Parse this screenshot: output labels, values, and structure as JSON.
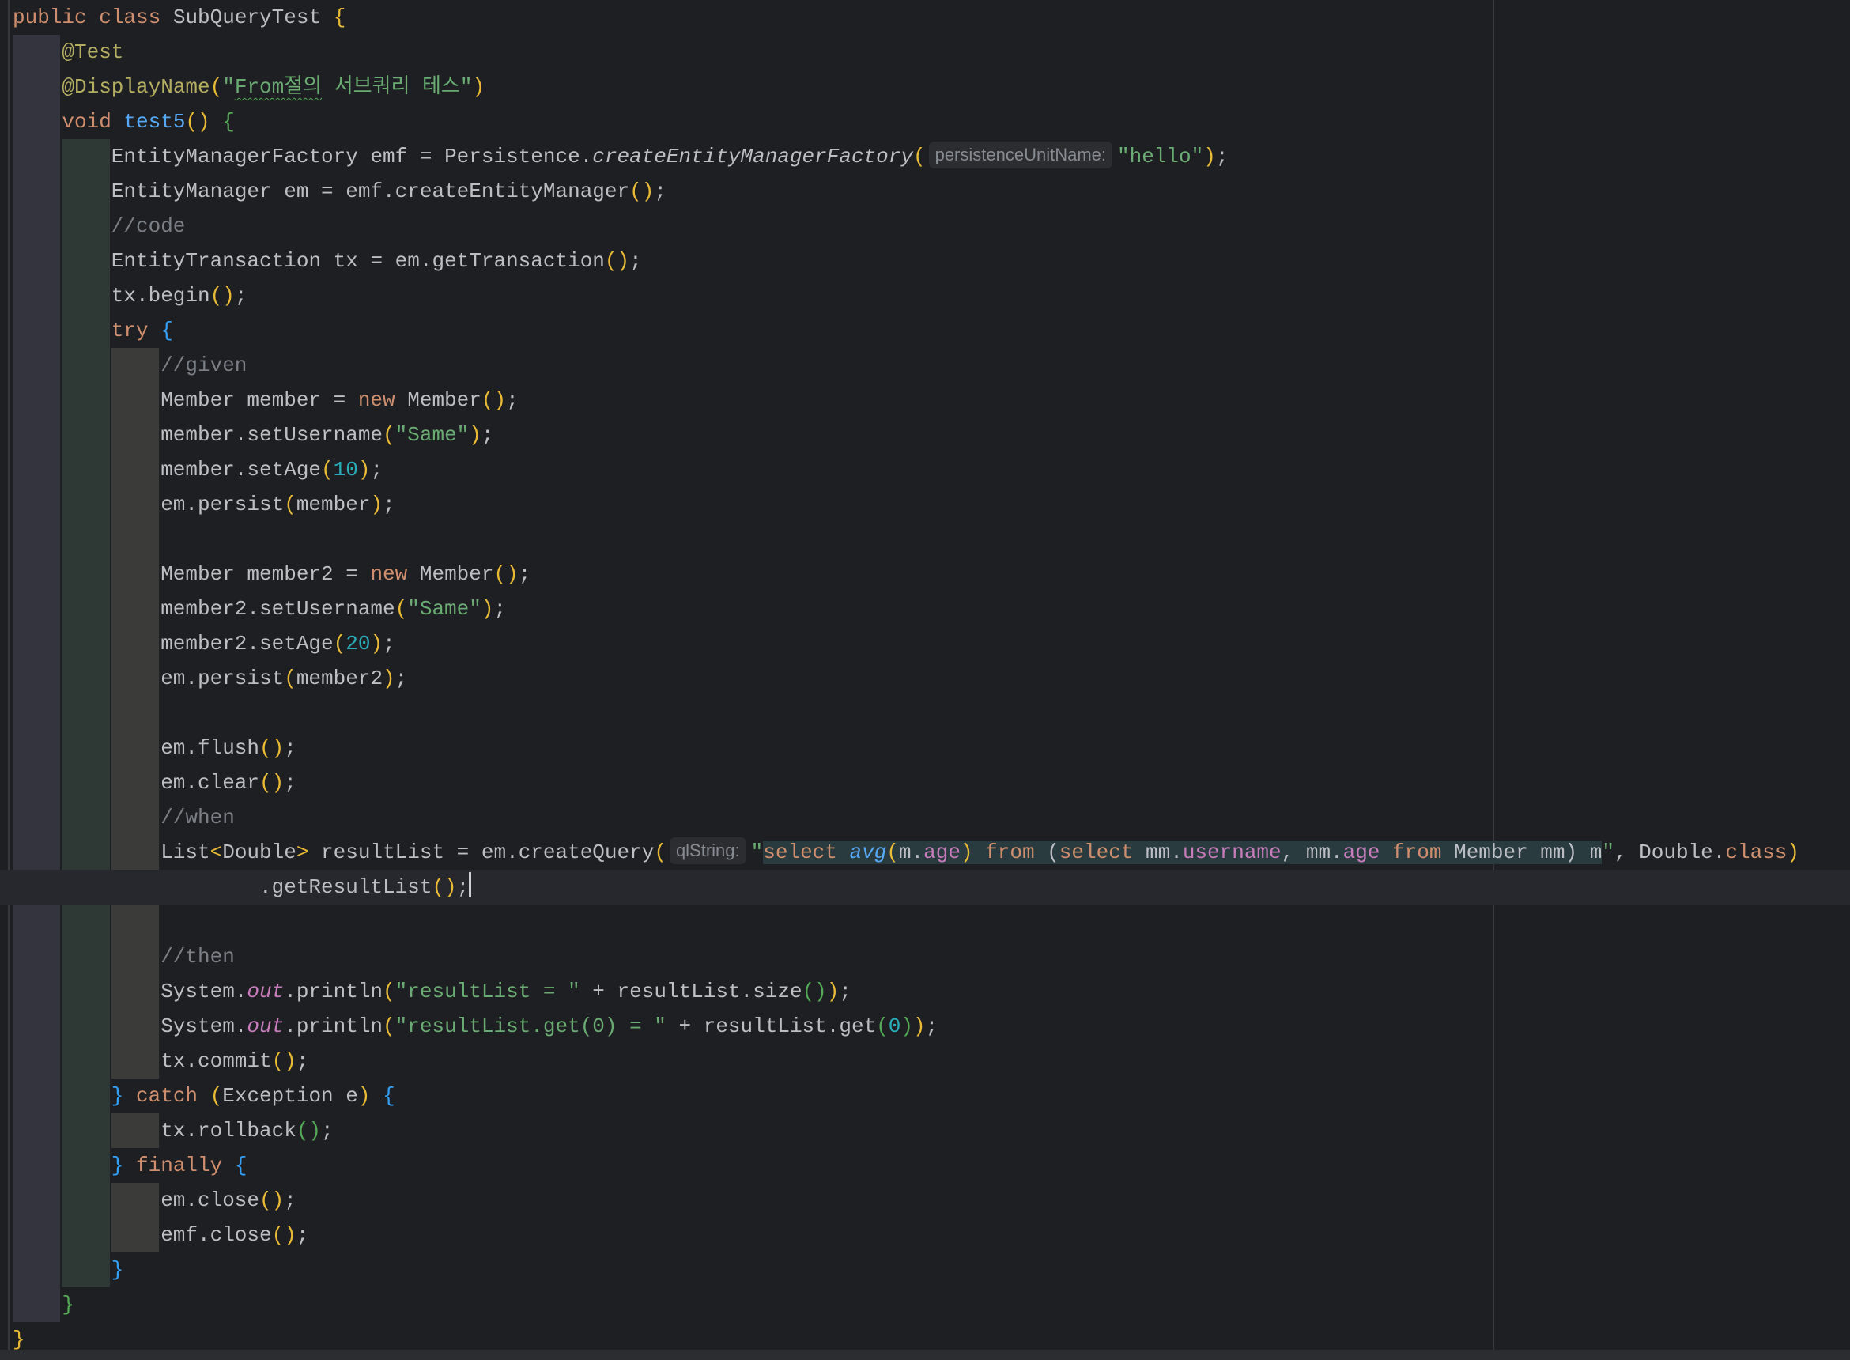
{
  "editor": {
    "file_class": "SubQueryTest",
    "current_line": 25,
    "caret_after_text": ".getResultList();",
    "colors": {
      "background": "#1e1f22",
      "current_line": "#26282e",
      "keyword": "#cf8e6d",
      "annotation": "#b3ae60",
      "string": "#6aab73",
      "number": "#2aacb8",
      "comment": "#7a7e85",
      "method_decl": "#56a8f5",
      "field": "#c77dbb",
      "text": "#bcbec4",
      "injected_language_bg": "#293b3f",
      "bracket_level_1": "#e8ba36",
      "bracket_level_2": "#54a857",
      "bracket_level_3": "#359ff4"
    },
    "lines": [
      {
        "indent": 0,
        "tokens": [
          {
            "t": "public class ",
            "c": "kw"
          },
          {
            "t": "SubQueryTest ",
            "c": "plain"
          },
          {
            "t": "{",
            "c": "b1"
          }
        ]
      },
      {
        "indent": 1,
        "tokens": [
          {
            "t": "@Test",
            "c": "ann"
          }
        ]
      },
      {
        "indent": 1,
        "tokens": [
          {
            "t": "@DisplayName",
            "c": "ann"
          },
          {
            "t": "(",
            "c": "b1"
          },
          {
            "t": "\"",
            "c": "str"
          },
          {
            "t": "From절의",
            "c": "str squiggle"
          },
          {
            "t": " 서브쿼리 테스\"",
            "c": "str"
          },
          {
            "t": ")",
            "c": "b1"
          }
        ]
      },
      {
        "indent": 1,
        "tokens": [
          {
            "t": "void ",
            "c": "kw"
          },
          {
            "t": "test5",
            "c": "fn"
          },
          {
            "t": "()",
            "c": "b1"
          },
          {
            "t": " ",
            "c": "plain"
          },
          {
            "t": "{",
            "c": "b2"
          }
        ]
      },
      {
        "indent": 2,
        "tokens": [
          {
            "t": "EntityManagerFactory emf = Persistence.",
            "c": "plain"
          },
          {
            "t": "createEntityManagerFactory",
            "c": "plain ital"
          },
          {
            "t": "(",
            "c": "b1"
          },
          {
            "hint": "persistenceUnitName:"
          },
          {
            "t": "\"hello\"",
            "c": "str"
          },
          {
            "t": ")",
            "c": "b1"
          },
          {
            "t": ";",
            "c": "plain"
          }
        ]
      },
      {
        "indent": 2,
        "tokens": [
          {
            "t": "EntityManager em = emf.createEntityManager",
            "c": "plain"
          },
          {
            "t": "()",
            "c": "b1"
          },
          {
            "t": ";",
            "c": "plain"
          }
        ]
      },
      {
        "indent": 2,
        "tokens": [
          {
            "t": "//code",
            "c": "cmt"
          }
        ]
      },
      {
        "indent": 2,
        "tokens": [
          {
            "t": "EntityTransaction tx = em.getTransaction",
            "c": "plain"
          },
          {
            "t": "()",
            "c": "b1"
          },
          {
            "t": ";",
            "c": "plain"
          }
        ]
      },
      {
        "indent": 2,
        "tokens": [
          {
            "t": "tx.begin",
            "c": "plain"
          },
          {
            "t": "()",
            "c": "b1"
          },
          {
            "t": ";",
            "c": "plain"
          }
        ]
      },
      {
        "indent": 2,
        "tokens": [
          {
            "t": "try ",
            "c": "kw"
          },
          {
            "t": "{",
            "c": "b3"
          }
        ]
      },
      {
        "indent": 3,
        "tokens": [
          {
            "t": "//given",
            "c": "cmt"
          }
        ]
      },
      {
        "indent": 3,
        "tokens": [
          {
            "t": "Member member = ",
            "c": "plain"
          },
          {
            "t": "new ",
            "c": "kw"
          },
          {
            "t": "Member",
            "c": "plain"
          },
          {
            "t": "()",
            "c": "b1"
          },
          {
            "t": ";",
            "c": "plain"
          }
        ]
      },
      {
        "indent": 3,
        "tokens": [
          {
            "t": "member.setUsername",
            "c": "plain"
          },
          {
            "t": "(",
            "c": "b1"
          },
          {
            "t": "\"Same\"",
            "c": "str"
          },
          {
            "t": ")",
            "c": "b1"
          },
          {
            "t": ";",
            "c": "plain"
          }
        ]
      },
      {
        "indent": 3,
        "tokens": [
          {
            "t": "member.setAge",
            "c": "plain"
          },
          {
            "t": "(",
            "c": "b1"
          },
          {
            "t": "10",
            "c": "num"
          },
          {
            "t": ")",
            "c": "b1"
          },
          {
            "t": ";",
            "c": "plain"
          }
        ]
      },
      {
        "indent": 3,
        "tokens": [
          {
            "t": "em.persist",
            "c": "plain"
          },
          {
            "t": "(",
            "c": "b1"
          },
          {
            "t": "member",
            "c": "plain"
          },
          {
            "t": ")",
            "c": "b1"
          },
          {
            "t": ";",
            "c": "plain"
          }
        ]
      },
      {
        "indent": 3,
        "tokens": []
      },
      {
        "indent": 3,
        "tokens": [
          {
            "t": "Member member2 = ",
            "c": "plain"
          },
          {
            "t": "new ",
            "c": "kw"
          },
          {
            "t": "Member",
            "c": "plain"
          },
          {
            "t": "()",
            "c": "b1"
          },
          {
            "t": ";",
            "c": "plain"
          }
        ]
      },
      {
        "indent": 3,
        "tokens": [
          {
            "t": "member2.setUsername",
            "c": "plain"
          },
          {
            "t": "(",
            "c": "b1"
          },
          {
            "t": "\"Same\"",
            "c": "str"
          },
          {
            "t": ")",
            "c": "b1"
          },
          {
            "t": ";",
            "c": "plain"
          }
        ]
      },
      {
        "indent": 3,
        "tokens": [
          {
            "t": "member2.setAge",
            "c": "plain"
          },
          {
            "t": "(",
            "c": "b1"
          },
          {
            "t": "20",
            "c": "num"
          },
          {
            "t": ")",
            "c": "b1"
          },
          {
            "t": ";",
            "c": "plain"
          }
        ]
      },
      {
        "indent": 3,
        "tokens": [
          {
            "t": "em.persist",
            "c": "plain"
          },
          {
            "t": "(",
            "c": "b1"
          },
          {
            "t": "member2",
            "c": "plain"
          },
          {
            "t": ")",
            "c": "b1"
          },
          {
            "t": ";",
            "c": "plain"
          }
        ]
      },
      {
        "indent": 3,
        "tokens": []
      },
      {
        "indent": 3,
        "tokens": [
          {
            "t": "em.flush",
            "c": "plain"
          },
          {
            "t": "()",
            "c": "b1"
          },
          {
            "t": ";",
            "c": "plain"
          }
        ]
      },
      {
        "indent": 3,
        "tokens": [
          {
            "t": "em.clear",
            "c": "plain"
          },
          {
            "t": "()",
            "c": "b1"
          },
          {
            "t": ";",
            "c": "plain"
          }
        ]
      },
      {
        "indent": 3,
        "tokens": [
          {
            "t": "//when",
            "c": "cmt"
          }
        ]
      },
      {
        "indent": 3,
        "tokens": [
          {
            "t": "List",
            "c": "plain"
          },
          {
            "t": "<",
            "c": "b1"
          },
          {
            "t": "Double",
            "c": "plain"
          },
          {
            "t": ">",
            "c": "b1"
          },
          {
            "t": " resultList = em.createQuery",
            "c": "plain"
          },
          {
            "t": "(",
            "c": "b1"
          },
          {
            "hint": "qlString:"
          },
          {
            "t": "\"",
            "c": "str"
          },
          {
            "t": "select ",
            "c": "kw inj"
          },
          {
            "t": "avg",
            "c": "fn ital inj"
          },
          {
            "t": "(",
            "c": "b1 inj"
          },
          {
            "t": "m.",
            "c": "plain inj"
          },
          {
            "t": "age",
            "c": "field inj"
          },
          {
            "t": ")",
            "c": "b1 inj"
          },
          {
            "t": " ",
            "c": "plain inj"
          },
          {
            "t": "from ",
            "c": "kw inj"
          },
          {
            "t": "(",
            "c": "plain inj"
          },
          {
            "t": "select ",
            "c": "kw inj"
          },
          {
            "t": "mm.",
            "c": "plain inj"
          },
          {
            "t": "username",
            "c": "field inj"
          },
          {
            "t": ", mm.",
            "c": "plain inj"
          },
          {
            "t": "age ",
            "c": "field inj"
          },
          {
            "t": "from ",
            "c": "kw inj"
          },
          {
            "t": "Member mm) m",
            "c": "plain inj"
          },
          {
            "t": "\"",
            "c": "str"
          },
          {
            "t": ", Double.",
            "c": "plain"
          },
          {
            "t": "class",
            "c": "kw"
          },
          {
            "t": ")",
            "c": "b1"
          }
        ]
      },
      {
        "indent": 5,
        "current": true,
        "tokens": [
          {
            "t": ".getResultList",
            "c": "plain"
          },
          {
            "t": "()",
            "c": "b1"
          },
          {
            "t": ";",
            "c": "plain"
          },
          {
            "caret": true
          }
        ]
      },
      {
        "indent": 3,
        "tokens": []
      },
      {
        "indent": 3,
        "tokens": [
          {
            "t": "//then",
            "c": "cmt"
          }
        ]
      },
      {
        "indent": 3,
        "tokens": [
          {
            "t": "System.",
            "c": "plain"
          },
          {
            "t": "out",
            "c": "static"
          },
          {
            "t": ".println",
            "c": "plain"
          },
          {
            "t": "(",
            "c": "b1"
          },
          {
            "t": "\"resultList = \"",
            "c": "str"
          },
          {
            "t": " + resultList.size",
            "c": "plain"
          },
          {
            "t": "()",
            "c": "b2"
          },
          {
            "t": ")",
            "c": "b1"
          },
          {
            "t": ";",
            "c": "plain"
          }
        ]
      },
      {
        "indent": 3,
        "tokens": [
          {
            "t": "System.",
            "c": "plain"
          },
          {
            "t": "out",
            "c": "static"
          },
          {
            "t": ".println",
            "c": "plain"
          },
          {
            "t": "(",
            "c": "b1"
          },
          {
            "t": "\"resultList.get(0) = \"",
            "c": "str"
          },
          {
            "t": " + resultList.get",
            "c": "plain"
          },
          {
            "t": "(",
            "c": "b2"
          },
          {
            "t": "0",
            "c": "num"
          },
          {
            "t": ")",
            "c": "b2"
          },
          {
            "t": ")",
            "c": "b1"
          },
          {
            "t": ";",
            "c": "plain"
          }
        ]
      },
      {
        "indent": 3,
        "tokens": [
          {
            "t": "tx.commit",
            "c": "plain"
          },
          {
            "t": "()",
            "c": "b1"
          },
          {
            "t": ";",
            "c": "plain"
          }
        ]
      },
      {
        "indent": 2,
        "tokens": [
          {
            "t": "}",
            "c": "b3"
          },
          {
            "t": " catch ",
            "c": "kw"
          },
          {
            "t": "(",
            "c": "b1"
          },
          {
            "t": "Exception e",
            "c": "plain"
          },
          {
            "t": ")",
            "c": "b1"
          },
          {
            "t": " ",
            "c": "plain"
          },
          {
            "t": "{",
            "c": "b3"
          }
        ]
      },
      {
        "indent": 3,
        "tokens": [
          {
            "t": "tx.rollback",
            "c": "plain"
          },
          {
            "t": "()",
            "c": "b2"
          },
          {
            "t": ";",
            "c": "plain"
          }
        ]
      },
      {
        "indent": 2,
        "tokens": [
          {
            "t": "}",
            "c": "b3"
          },
          {
            "t": " finally ",
            "c": "kw"
          },
          {
            "t": "{",
            "c": "b3"
          }
        ]
      },
      {
        "indent": 3,
        "tokens": [
          {
            "t": "em.close",
            "c": "plain"
          },
          {
            "t": "()",
            "c": "b1"
          },
          {
            "t": ";",
            "c": "plain"
          }
        ]
      },
      {
        "indent": 3,
        "tokens": [
          {
            "t": "emf.close",
            "c": "plain"
          },
          {
            "t": "()",
            "c": "b1"
          },
          {
            "t": ";",
            "c": "plain"
          }
        ]
      },
      {
        "indent": 2,
        "tokens": [
          {
            "t": "}",
            "c": "b3"
          }
        ]
      },
      {
        "indent": 1,
        "tokens": [
          {
            "t": "}",
            "c": "b2"
          }
        ]
      },
      {
        "indent": 0,
        "tokens": [
          {
            "t": "}",
            "c": "b1"
          }
        ]
      }
    ]
  }
}
